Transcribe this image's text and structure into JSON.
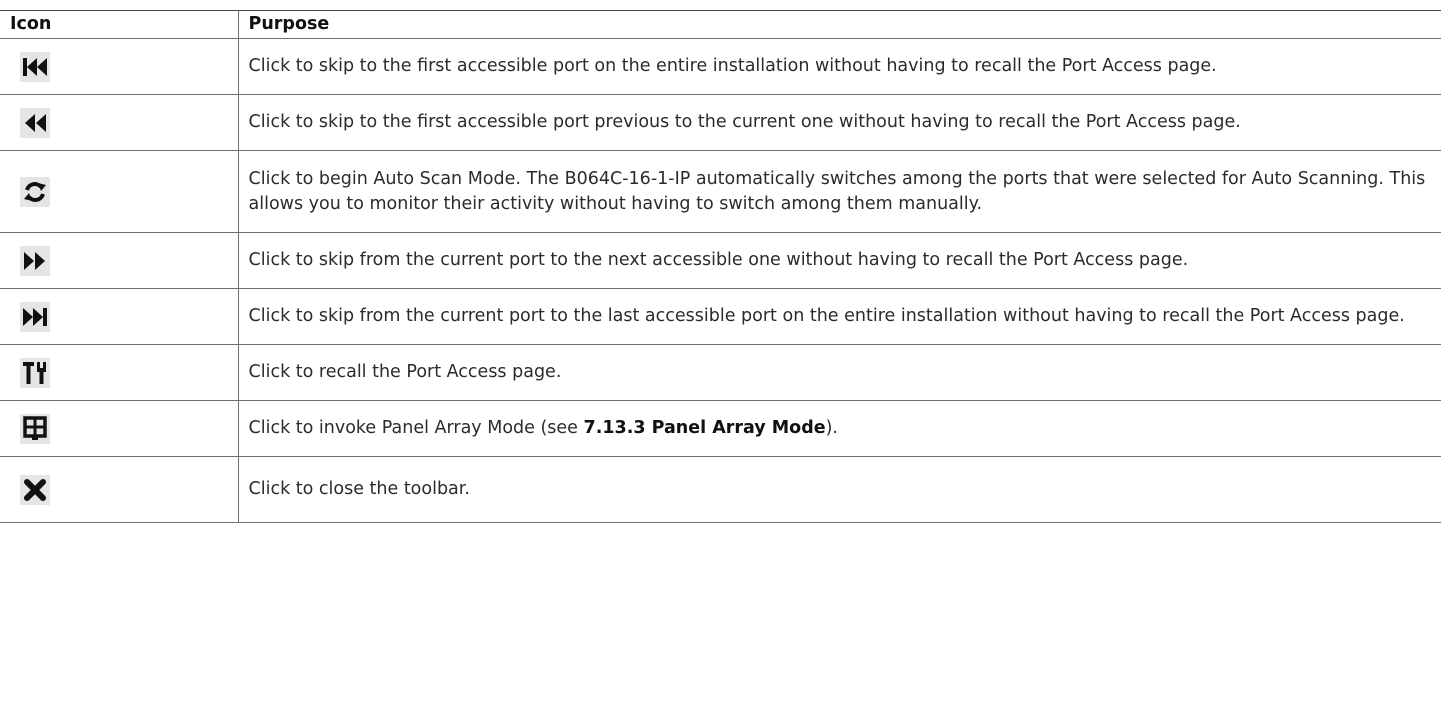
{
  "table": {
    "headers": {
      "icon": "Icon",
      "purpose": "Purpose"
    },
    "rows": [
      {
        "icon": "skip-to-first-icon",
        "purpose": "Click to skip to the first accessible port on the entire installation without having to recall the Port Access page."
      },
      {
        "icon": "skip-previous-icon",
        "purpose": "Click to skip to the first accessible port previous to the current one without having to recall the Port Access page."
      },
      {
        "icon": "auto-scan-icon",
        "purpose": "Click to begin Auto Scan Mode. The B064C-16-1-IP automatically switches among the ports that were selected for Auto Scanning. This allows you to monitor their activity without having to switch among them manually."
      },
      {
        "icon": "skip-next-icon",
        "purpose": "Click to skip from the current port to the next accessible one without having to recall the Port Access page."
      },
      {
        "icon": "skip-to-last-icon",
        "purpose": "Click to skip from the current port to the last accessible port on the entire installation without having to recall the Port Access page."
      },
      {
        "icon": "tools-icon",
        "purpose": "Click to recall the Port Access page."
      },
      {
        "icon": "panel-array-icon",
        "purpose_prefix": "Click to invoke Panel Array Mode (see ",
        "purpose_bold": "7.13.3 Panel Array Mode",
        "purpose_suffix": ")."
      },
      {
        "icon": "close-icon",
        "purpose": "Click to close the toolbar."
      }
    ]
  }
}
